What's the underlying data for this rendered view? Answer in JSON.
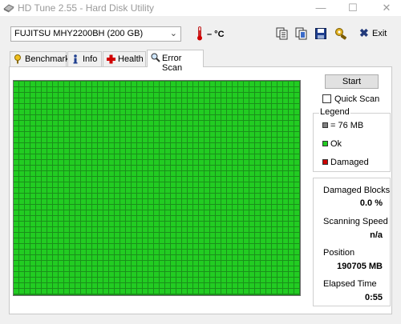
{
  "window": {
    "title": "HD Tune 2.55 - Hard Disk Utility",
    "minimize": "—",
    "maximize": "☐",
    "close": "✕"
  },
  "toolbar": {
    "drive": "FUJITSU MHY2200BH (200 GB)",
    "temperature": "– °C",
    "exit_label": "Exit",
    "exit_icon": "✖",
    "icons": [
      "copy-text-icon",
      "copy-screenshot-icon",
      "save-icon",
      "options-icon",
      "exit-icon"
    ]
  },
  "tabs": [
    {
      "label": "Benchmark",
      "icon": "benchmark-icon",
      "active": false
    },
    {
      "label": "Info",
      "icon": "info-icon",
      "active": false
    },
    {
      "label": "Health",
      "icon": "health-icon",
      "active": false
    },
    {
      "label": "Error Scan",
      "icon": "magnifier-icon",
      "active": true
    }
  ],
  "error_scan": {
    "start_label": "Start",
    "quick_scan_label": "Quick Scan",
    "quick_scan_checked": false,
    "legend_title": "Legend",
    "legend": [
      {
        "label": "= 76 MB",
        "color": "#808080"
      },
      {
        "label": "Ok",
        "color": "#22cc22"
      },
      {
        "label": "Damaged",
        "color": "#cc0000"
      }
    ],
    "stats": [
      {
        "label": "Damaged Blocks",
        "value": "0.0 %"
      },
      {
        "label": "Scanning Speed",
        "value": "n/a"
      },
      {
        "label": "Position",
        "value": "190705 MB"
      },
      {
        "label": "Elapsed Time",
        "value": "0:55"
      }
    ],
    "block_state": "Ok",
    "ok_color": "#22cc22",
    "grid_line_color": "#1a8f1a"
  }
}
